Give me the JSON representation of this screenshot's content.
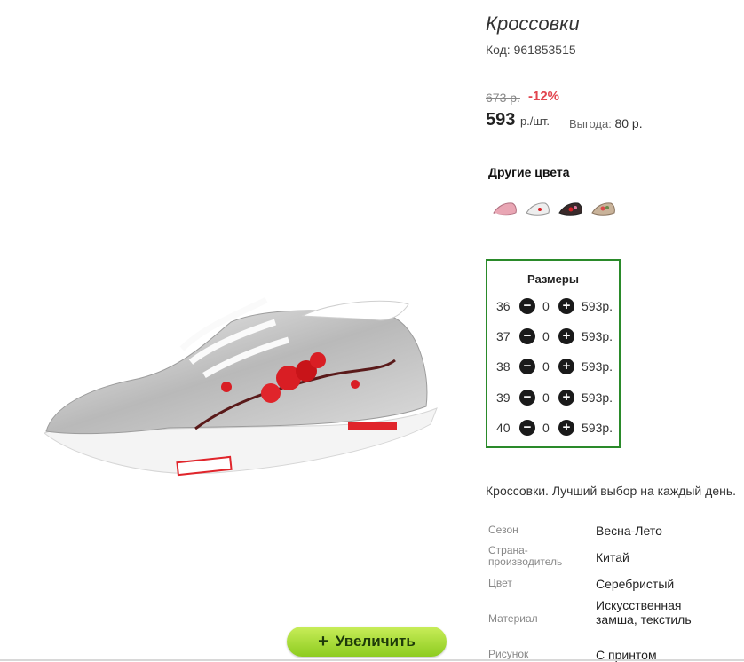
{
  "product": {
    "title": "Кроссовки",
    "code_label": "Код:",
    "code": "961853515",
    "old_price": "673 р.",
    "discount": "-12%",
    "price": "593",
    "price_unit": "р./шт.",
    "savings_label": "Выгода:",
    "savings_value": "80 р.",
    "description": "Кроссовки. Лучший выбор на каждый день."
  },
  "zoom_button": {
    "label": "Увеличить",
    "icon": "plus-icon"
  },
  "other_colors": {
    "title": "Другие цвета",
    "swatches": [
      {
        "name": "pink",
        "color": "#e9a6b4"
      },
      {
        "name": "white",
        "color": "#e6e6e6"
      },
      {
        "name": "black-floral",
        "color": "#3a2a2a"
      },
      {
        "name": "beige-floral",
        "color": "#c9b39a"
      }
    ]
  },
  "sizes": {
    "title": "Размеры",
    "rows": [
      {
        "size": "36",
        "qty": "0",
        "price": "593р."
      },
      {
        "size": "37",
        "qty": "0",
        "price": "593р."
      },
      {
        "size": "38",
        "qty": "0",
        "price": "593р."
      },
      {
        "size": "39",
        "qty": "0",
        "price": "593р."
      },
      {
        "size": "40",
        "qty": "0",
        "price": "593р."
      }
    ]
  },
  "specs": [
    {
      "label": "Сезон",
      "value": "Весна-Лето"
    },
    {
      "label": "Страна-производитель",
      "value": "Китай"
    },
    {
      "label": "Цвет",
      "value": "Серебристый"
    },
    {
      "label": "Материал",
      "value": "Искусственная замша, текстиль"
    },
    {
      "label": "Рисунок",
      "value": "С принтом"
    }
  ],
  "colors": {
    "accent_green": "#2a8a2a",
    "discount_red": "#e2464f",
    "button_green": "#8dcc1f"
  }
}
